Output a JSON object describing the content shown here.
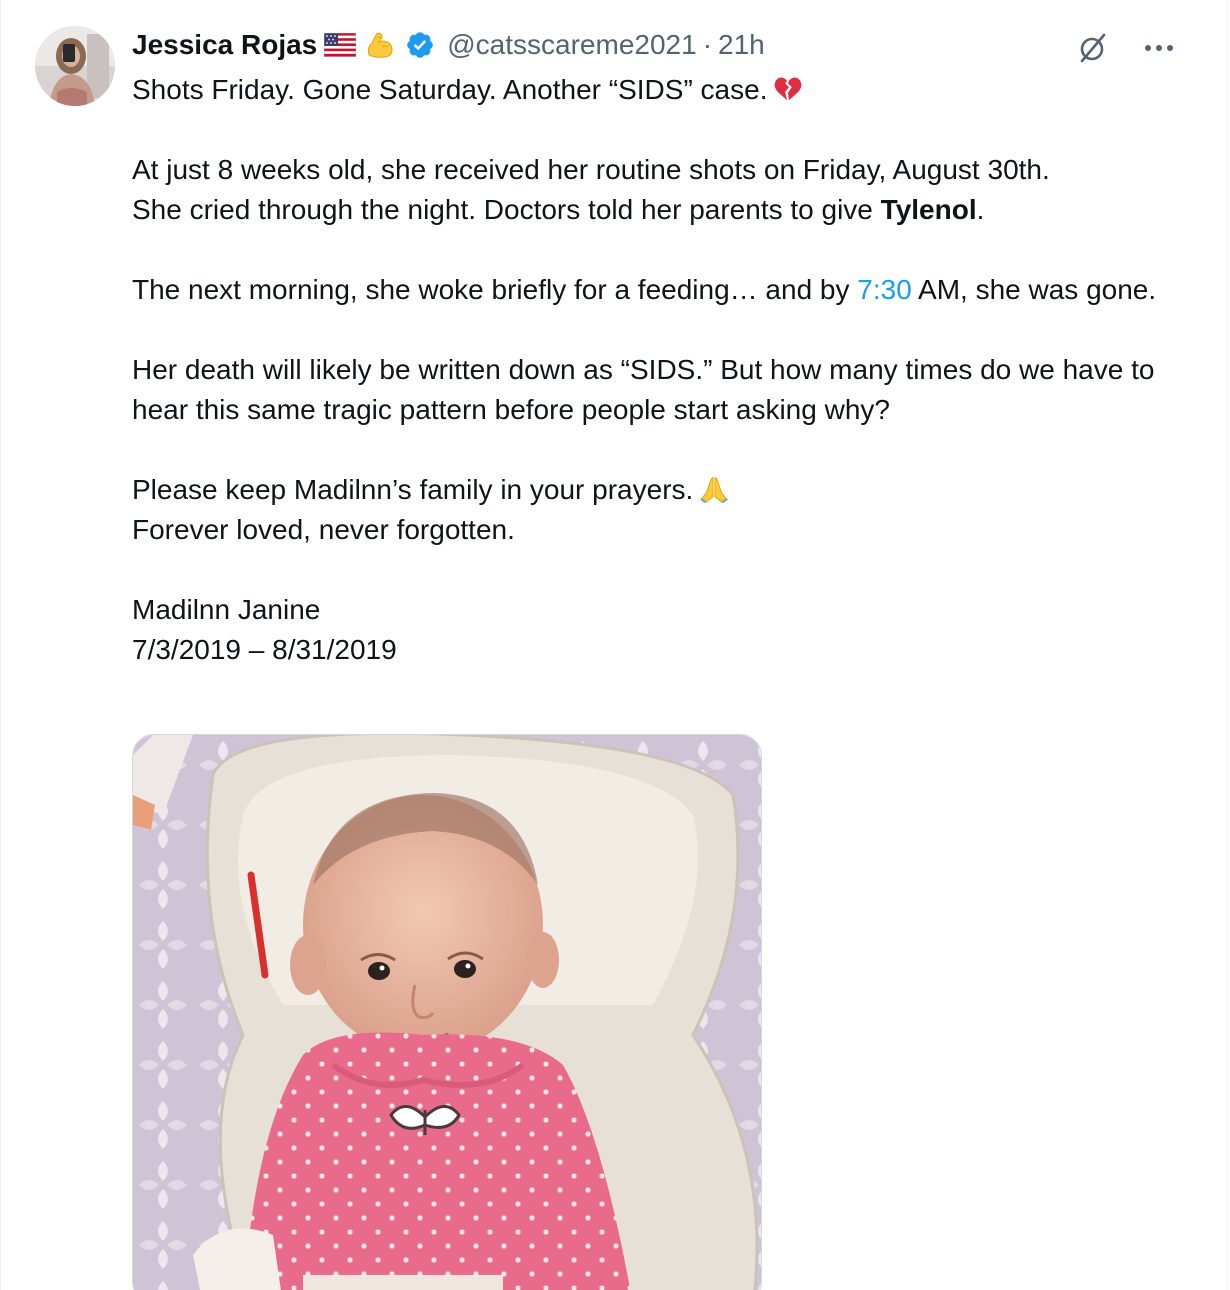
{
  "tweet": {
    "author": {
      "display_name": "Jessica Rojas",
      "handle": "@catsscareme2021",
      "badges": [
        "us-flag-emoji",
        "flexed-biceps-emoji",
        "verified-badge-icon"
      ],
      "avatar": "avatar-image"
    },
    "separator": "·",
    "timestamp": "21h",
    "actions": {
      "grok_icon": "grok-icon",
      "more_icon": "more-icon"
    },
    "text": {
      "line1": "Shots Friday. Gone Saturday. Another “SIDS” case.",
      "line1_emoji": "broken-heart-emoji",
      "p2_line1": "At just 8 weeks old, she received her routine shots on Friday, August 30th.",
      "p2_line2_pre": "She cried through the night. Doctors told her parents to give ",
      "p2_line2_bold": "Tylenol",
      "p2_line2_post": ".",
      "p3_pre": "The next morning, she woke briefly for a feeding… and by ",
      "p3_link": "7:30",
      "p3_post": " AM, she was gone.",
      "p4": "Her death will likely be written down as “SIDS.” But how many times do we have to hear this same tragic pattern before people start asking why?",
      "p5_line1": "Please keep Madilnn’s family in your prayers.",
      "p5_line1_emoji": "folded-hands-emoji",
      "p5_line2": "Forever loved, never forgotten.",
      "p6_line1": "Madilnn Janine",
      "p6_line2": "7/3/2019 – 8/31/2019"
    },
    "media": {
      "description_icon": "photo-of-infant-in-pink-onesie"
    },
    "colors": {
      "text": "#0f1419",
      "secondary": "#536471",
      "link": "#1d9bf0",
      "verified": "#1d9bf0"
    }
  }
}
